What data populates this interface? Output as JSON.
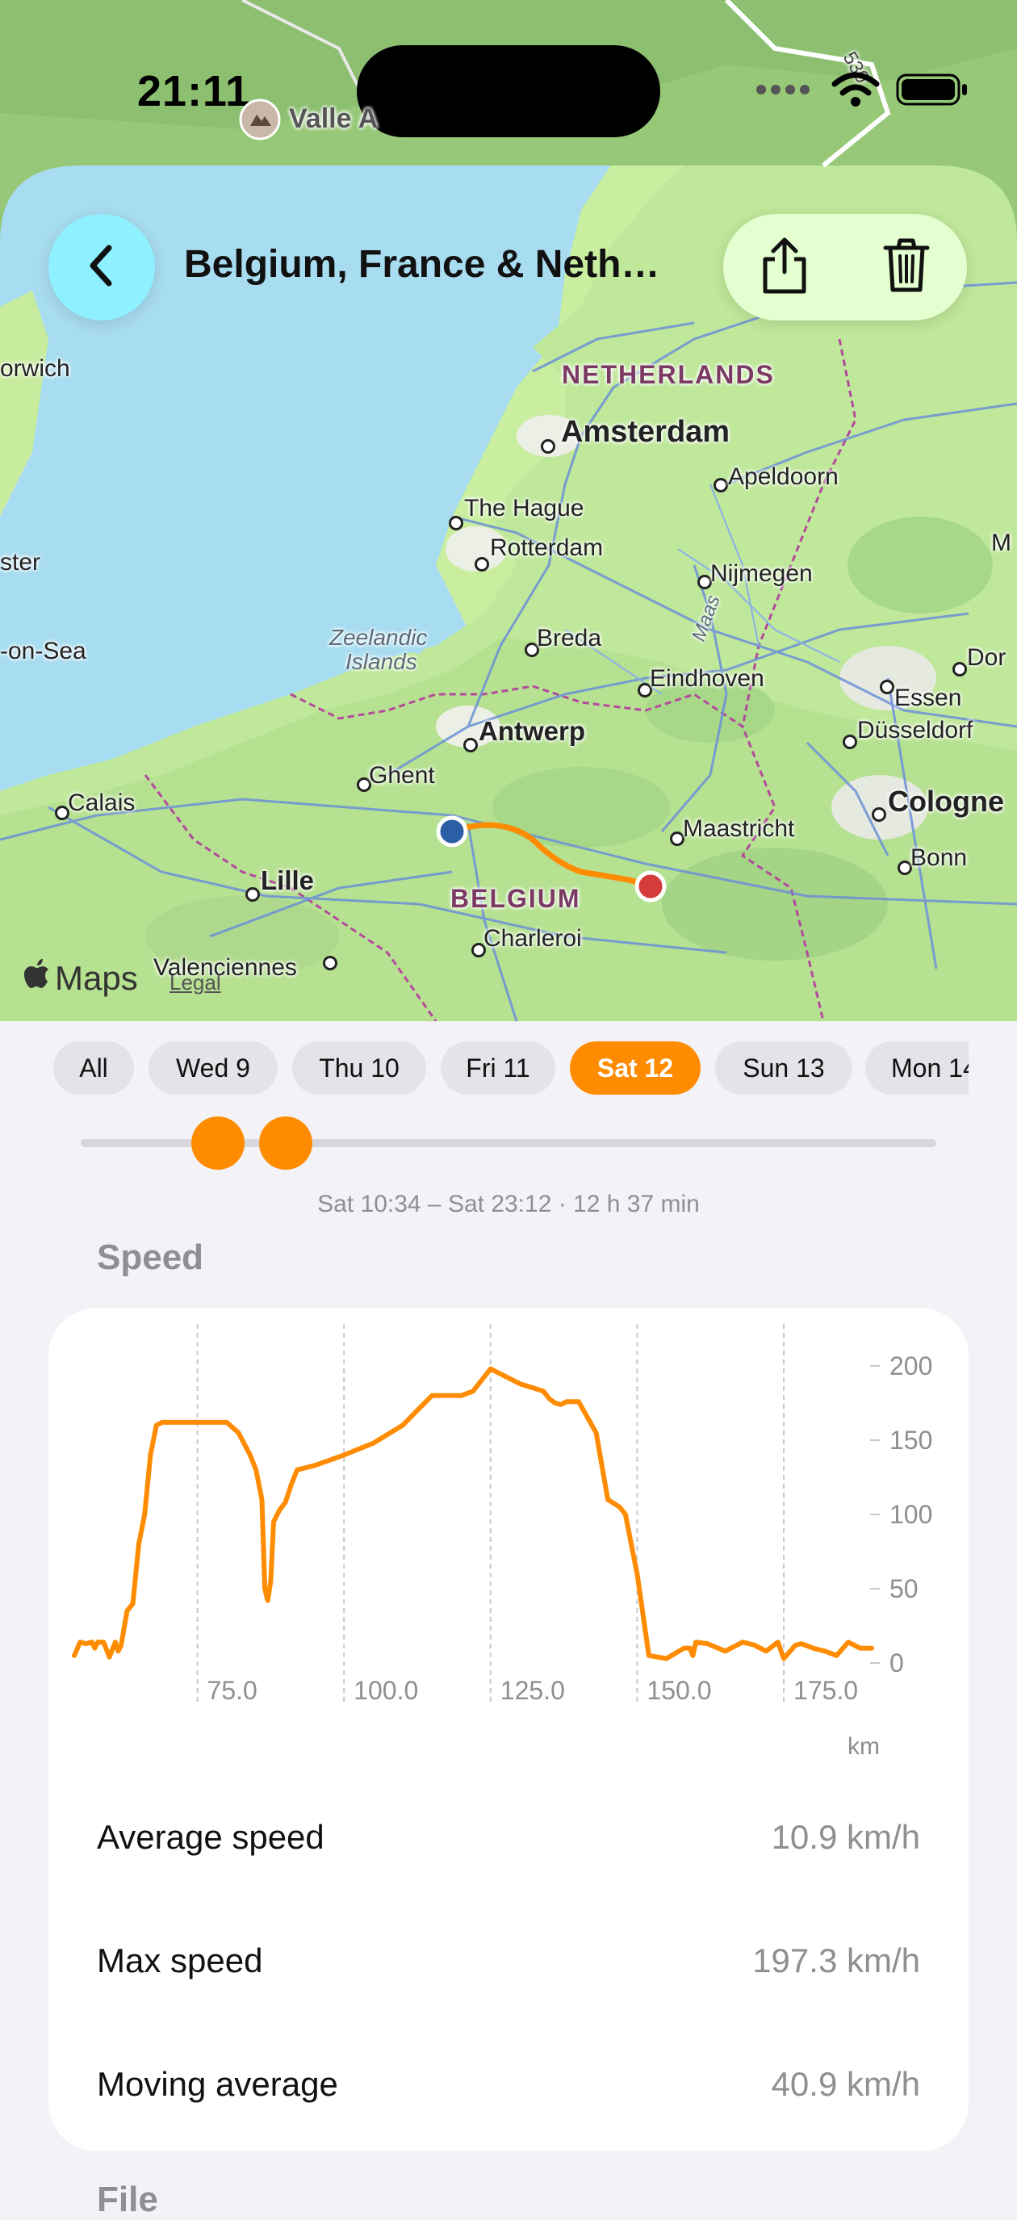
{
  "status_bar": {
    "time": "21:11"
  },
  "header": {
    "title": "Belgium, France & Neth…",
    "back_icon": "chevron-left-icon",
    "share_icon": "share-icon",
    "delete_icon": "trash-icon"
  },
  "map": {
    "top_poi": "Valle A",
    "road_number": "530",
    "countries": [
      "NETHERLANDS",
      "BELGIUM"
    ],
    "cities": {
      "amsterdam": "Amsterdam",
      "apeldoorn": "Apeldoorn",
      "the_hague": "The Hague",
      "rotterdam": "Rotterdam",
      "nijmegen": "Nijmegen",
      "breda": "Breda",
      "eindhoven": "Eindhoven",
      "antwerp": "Antwerp",
      "ghent": "Ghent",
      "calais": "Calais",
      "lille": "Lille",
      "maastricht": "Maastricht",
      "charleroi": "Charleroi",
      "valenciennes": "Valenciennes",
      "essen": "Essen",
      "dusseldorf": "Düsseldorf",
      "cologne": "Cologne",
      "bonn": "Bonn",
      "norwich": "orwich",
      "ster": "ster",
      "on_sea": "-on-Sea",
      "dor": "Dor",
      "m": "M"
    },
    "water_labels": {
      "zeelandic": "Zeelandic",
      "islands": "Islands",
      "maas": "Maas"
    },
    "attribution": "Maps",
    "legal": "Legal",
    "route_color": "#ff8c00",
    "start_color": "#2a5fa6",
    "end_color": "#d43b3b"
  },
  "days": [
    {
      "label": "All",
      "selected": false
    },
    {
      "label": "Wed 9",
      "selected": false
    },
    {
      "label": "Thu 10",
      "selected": false
    },
    {
      "label": "Fri 11",
      "selected": false
    },
    {
      "label": "Sat 12",
      "selected": true
    },
    {
      "label": "Sun 13",
      "selected": false
    },
    {
      "label": "Mon 14",
      "selected": false
    }
  ],
  "slider": {
    "start_fraction": 0.16,
    "end_fraction": 0.24
  },
  "range_text": "Sat 10:34 – Sat 23:12 · 12 h 37 min",
  "speed_section": {
    "title": "Speed"
  },
  "chart_data": {
    "type": "line",
    "x_unit": "km",
    "x_ticks": [
      "75.0",
      "100.0",
      "125.0",
      "150.0",
      "175.0"
    ],
    "y_ticks": [
      "200",
      "150",
      "100",
      "50",
      "0"
    ],
    "xlim": [
      54,
      190
    ],
    "ylim": [
      0,
      200
    ],
    "series": [
      {
        "color": "#ff8c00",
        "x": [
          54,
          55,
          56,
          57,
          57.5,
          58,
          59,
          60,
          61,
          61.5,
          62,
          63,
          64,
          65,
          66,
          67,
          68,
          69,
          70,
          72,
          75,
          78,
          80,
          82,
          84,
          85,
          86,
          86.5,
          87,
          87.5,
          88,
          89,
          90,
          91,
          92,
          95,
          100,
          105,
          110,
          115,
          118,
          120,
          122,
          125,
          130,
          134,
          135,
          136,
          137,
          138,
          140,
          143,
          145,
          147,
          148,
          148.5,
          149,
          150,
          152,
          155,
          158,
          159,
          159.5,
          160,
          162,
          165,
          168,
          170,
          172,
          174,
          175,
          177,
          178,
          180,
          182,
          184,
          186,
          188,
          190
        ],
        "y": [
          5,
          14,
          13,
          14,
          10,
          14,
          14,
          4,
          14,
          8,
          12,
          35,
          40,
          80,
          100,
          140,
          160,
          162,
          162,
          162,
          162,
          162,
          162,
          155,
          140,
          130,
          110,
          50,
          42,
          55,
          95,
          103,
          108,
          120,
          130,
          133,
          140,
          148,
          160,
          180,
          180,
          180,
          183,
          198,
          188,
          183,
          178,
          175,
          174,
          176,
          176,
          155,
          110,
          105,
          100,
          90,
          80,
          60,
          5,
          3,
          10,
          10,
          5,
          14,
          13,
          8,
          14,
          12,
          8,
          14,
          3,
          12,
          13,
          10,
          8,
          5,
          14,
          10,
          10
        ]
      }
    ]
  },
  "stats": [
    {
      "label": "Average speed",
      "value": "10.9 km/h"
    },
    {
      "label": "Max speed",
      "value": "197.3 km/h"
    },
    {
      "label": "Moving average",
      "value": "40.9 km/h"
    }
  ],
  "next_section": {
    "title": "File"
  }
}
